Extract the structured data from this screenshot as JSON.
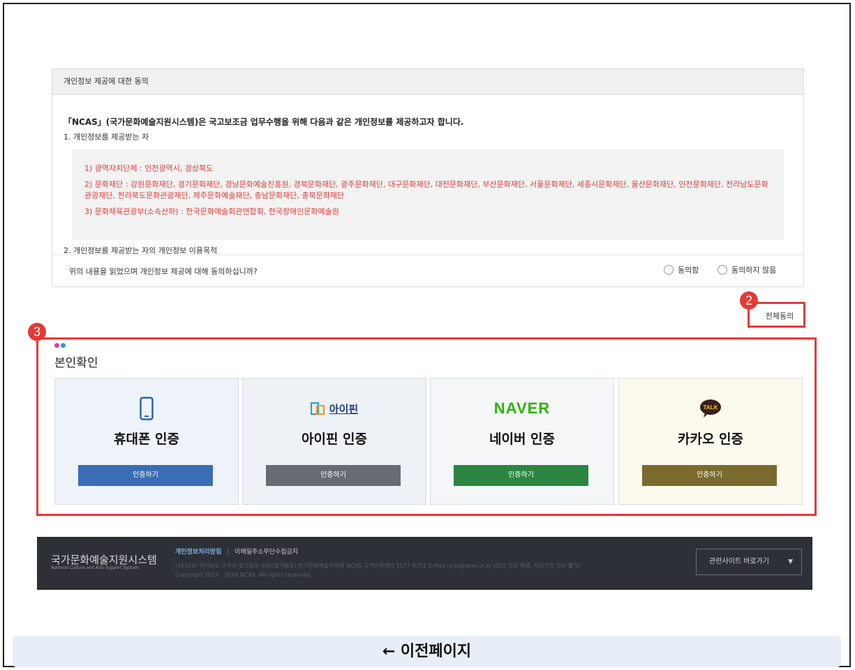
{
  "consent": {
    "header": "개인정보 제공에 대한 동의",
    "intro": "「NCAS」(국가문화예술지원시스템)은 국고보조금 업무수행을 위해 다음과 같은 개인정보를 제공하고자 합니다.",
    "section1": "1. 개인정보를 제공받는 자",
    "recipients": [
      "1) 광역자치단체 : 인천광역시, 경상북도",
      "2) 문화재단 : 강원문화재단, 경기문화재단, 경남문화예술진흥원, 경북문화재단, 광주문화재단, 대구문화재단, 대전문화재단, 부산문화재단, 서울문화재단, 세종시문화재단, 울산문화재단, 인천문화재단, 전라남도문화관광재단, 전라북도문화관광재단, 제주문화예술재단, 충남문화재단, 충북문화재단",
      "3) 문화체육관광부(소속산하) : 한국문화예술회관연합회, 한국장애인문화예술원"
    ],
    "section2": "2. 개인정보를 제공받는 자의 개인정보 이용목적",
    "question": "위의 내용을 읽었으며 개인정보 제공에 대해 동의하십니까?",
    "agree_label": "동의함",
    "disagree_label": "동의하지 않음"
  },
  "markers": {
    "m2": "2",
    "m3": "3"
  },
  "all_agree_label": "전체동의",
  "identity": {
    "title": "본인확인",
    "dot_colors": [
      "#e0409a",
      "#3d8fe0"
    ],
    "cards": [
      {
        "title": "휴대폰 인증",
        "button": "인증하기",
        "icon": "smartphone-icon",
        "bg": "#eef3f9",
        "btn_color": "#3a6db5"
      },
      {
        "title": "아이핀 인증",
        "button": "인증하기",
        "icon": "ipin-logo",
        "logo_text": "아이핀",
        "bg": "#eef1f5",
        "btn_color": "#666b74"
      },
      {
        "title": "네이버 인증",
        "button": "인증하기",
        "icon": "naver-logo",
        "logo_text": "NAVER",
        "bg": "#f4f6f8",
        "btn_color": "#2c8540"
      },
      {
        "title": "카카오 인증",
        "button": "인증하기",
        "icon": "kakao-talk-icon",
        "logo_text": "TALK",
        "bg": "#fcf9ee",
        "btn_color": "#7a6a2e"
      }
    ]
  },
  "footer": {
    "title": "국가문화예술지원시스템",
    "subtitle": "National Culture and Arts Support System",
    "link_privacy": "개인정보처리방침",
    "separator": "|",
    "link_email": "이메일주소무단수집금지",
    "address": "(58326) 전라남도 나주시 빛가람로 640(빛가람동) 한국문화예술위원회   NCAS 고객만족센터 1577-8751   E-Mail ncas@arko.or.kr (정신 전담 해결, 지원신청 접수 불가)",
    "copyright": "Copyright 2013 - 2016 NCAS. All rights reserved.",
    "related_sites": "관련사이트 바로가기"
  },
  "prev_page": "← 이전페이지"
}
